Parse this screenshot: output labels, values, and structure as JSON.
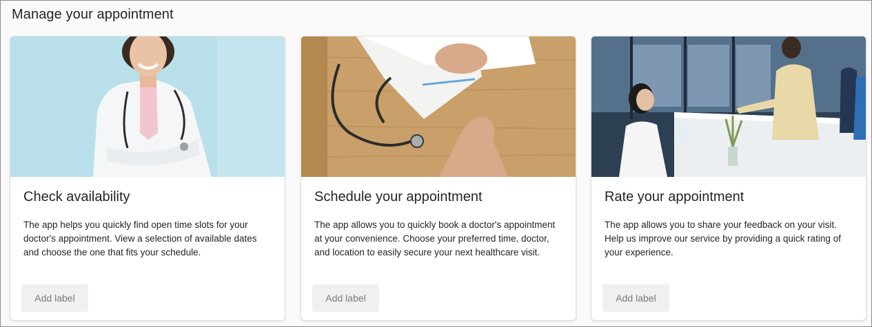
{
  "page": {
    "title": "Manage your appointment"
  },
  "cards": [
    {
      "image_icon": "doctor-portrait-photo",
      "title": "Check availability",
      "description": "The app helps you quickly find open time slots for your doctor's appointment. View a selection of available dates and choose the one that fits your schedule.",
      "button_label": "Add label"
    },
    {
      "image_icon": "stethoscope-desk-photo",
      "title": "Schedule your appointment",
      "description": "The app allows you to quickly book a doctor's appointment at your convenience. Choose your preferred time, doctor, and location to easily secure your next healthcare visit.",
      "button_label": "Add label"
    },
    {
      "image_icon": "reception-desk-photo",
      "title": "Rate your appointment",
      "description": "The app allows you to share your feedback on your visit. Help us improve our service by providing a quick rating of your experience.",
      "button_label": "Add label"
    }
  ],
  "colors": {
    "page_background": "#fafafa",
    "card_background": "#ffffff",
    "text": "#242424",
    "button_background": "#f0f0f0",
    "button_text": "#7a7a7a"
  }
}
